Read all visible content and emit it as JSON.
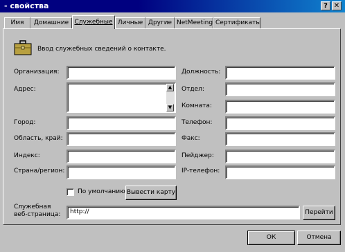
{
  "window": {
    "title": "- свойства",
    "help_button": "?",
    "close_button": "✕"
  },
  "tabs": [
    {
      "label": "Имя"
    },
    {
      "label": "Домашние"
    },
    {
      "label": "Служебные"
    },
    {
      "label": "Личные"
    },
    {
      "label": "Другие"
    },
    {
      "label": "NetMeeting"
    },
    {
      "label": "Сертификаты"
    }
  ],
  "active_tab": "Служебные",
  "intro": {
    "text": "Ввод служебных сведений о контакте.",
    "icon": "briefcase-icon"
  },
  "left_fields": {
    "organization": {
      "label": "Организация:",
      "value": ""
    },
    "address": {
      "label": "Адрес:",
      "value": ""
    },
    "city": {
      "label": "Город:",
      "value": ""
    },
    "region": {
      "label": "Область, край:",
      "value": ""
    },
    "zip": {
      "label": "Индекс:",
      "value": ""
    },
    "country": {
      "label": "Страна/регион:",
      "value": ""
    }
  },
  "right_fields": {
    "position": {
      "label": "Должность:",
      "value": ""
    },
    "department": {
      "label": "Отдел:",
      "value": ""
    },
    "room": {
      "label": "Комната:",
      "value": ""
    },
    "phone": {
      "label": "Телефон:",
      "value": ""
    },
    "fax": {
      "label": "Факс:",
      "value": ""
    },
    "pager": {
      "label": "Пейджер:",
      "value": ""
    },
    "ip_phone": {
      "label": "IP-телефон:",
      "value": ""
    }
  },
  "default_checkbox": {
    "label": "По умолчанию",
    "checked": false
  },
  "map_button": "Вывести карту",
  "webpage": {
    "label_line1": "Служебная",
    "label_line2": "веб-страница:",
    "value": "http://",
    "go_button": "Перейти"
  },
  "footer": {
    "ok": "ОК",
    "cancel": "Отмена"
  }
}
